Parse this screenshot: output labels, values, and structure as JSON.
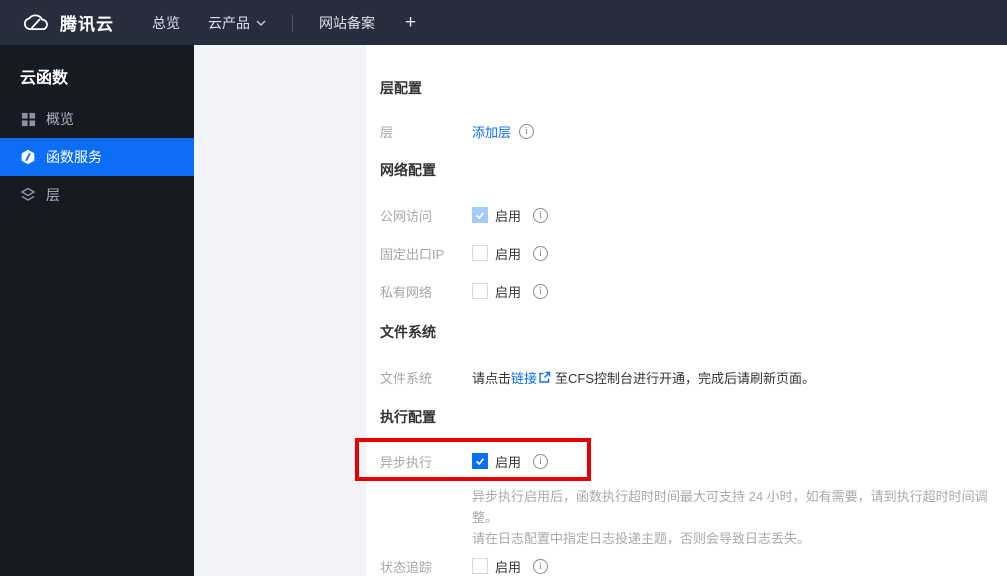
{
  "navbar": {
    "brand": "腾讯云",
    "overview": "总览",
    "cloud_products": "云产品",
    "website_record": "网站备案",
    "plus": "+"
  },
  "sidebar": {
    "title": "云函数",
    "items": [
      {
        "label": "概览",
        "icon": "grid-icon",
        "active": false
      },
      {
        "label": "函数服务",
        "icon": "hexagon-function-icon",
        "active": true
      },
      {
        "label": "层",
        "icon": "layers-icon",
        "active": false
      }
    ]
  },
  "content": {
    "sections": [
      {
        "title": "层配置",
        "rows": [
          {
            "label": "层",
            "link": "添加层",
            "info": true
          }
        ]
      },
      {
        "title": "网络配置",
        "rows": [
          {
            "label": "公网访问",
            "checkbox_text": "启用",
            "checked": true,
            "disabled": true,
            "info": true
          },
          {
            "label": "固定出口IP",
            "checkbox_text": "启用",
            "checked": false,
            "info": true
          },
          {
            "label": "私有网络",
            "checkbox_text": "启用",
            "checked": false,
            "info": true
          }
        ]
      },
      {
        "title": "文件系统",
        "rows": [
          {
            "label": "文件系统",
            "text_before": "请点击",
            "link": "链接",
            "external_icon": true,
            "text_after": "至CFS控制台进行开通，完成后请刷新页面。"
          }
        ]
      },
      {
        "title": "执行配置",
        "rows": [
          {
            "label": "异步执行",
            "checkbox_text": "启用",
            "checked": true,
            "info": true,
            "highlighted": true,
            "description": [
              "异步执行启用后，函数执行超时时间最大可支持 24 小时，如有需要，请到执行超时时间调整。",
              "请在日志配置中指定日志投递主题，否则会导致日志丢失。"
            ]
          },
          {
            "label": "状态追踪",
            "checkbox_text": "启用",
            "checked": false,
            "info": true
          }
        ]
      }
    ]
  },
  "colors": {
    "accent_blue": "#0b6ef5",
    "highlight_red": "#e60000",
    "disabled_checked_blue": "#a3cdf8",
    "navbar_bg": "#262e3d",
    "sidebar_bg": "#171a23",
    "gray_panel_bg": "#f2f4f7"
  }
}
